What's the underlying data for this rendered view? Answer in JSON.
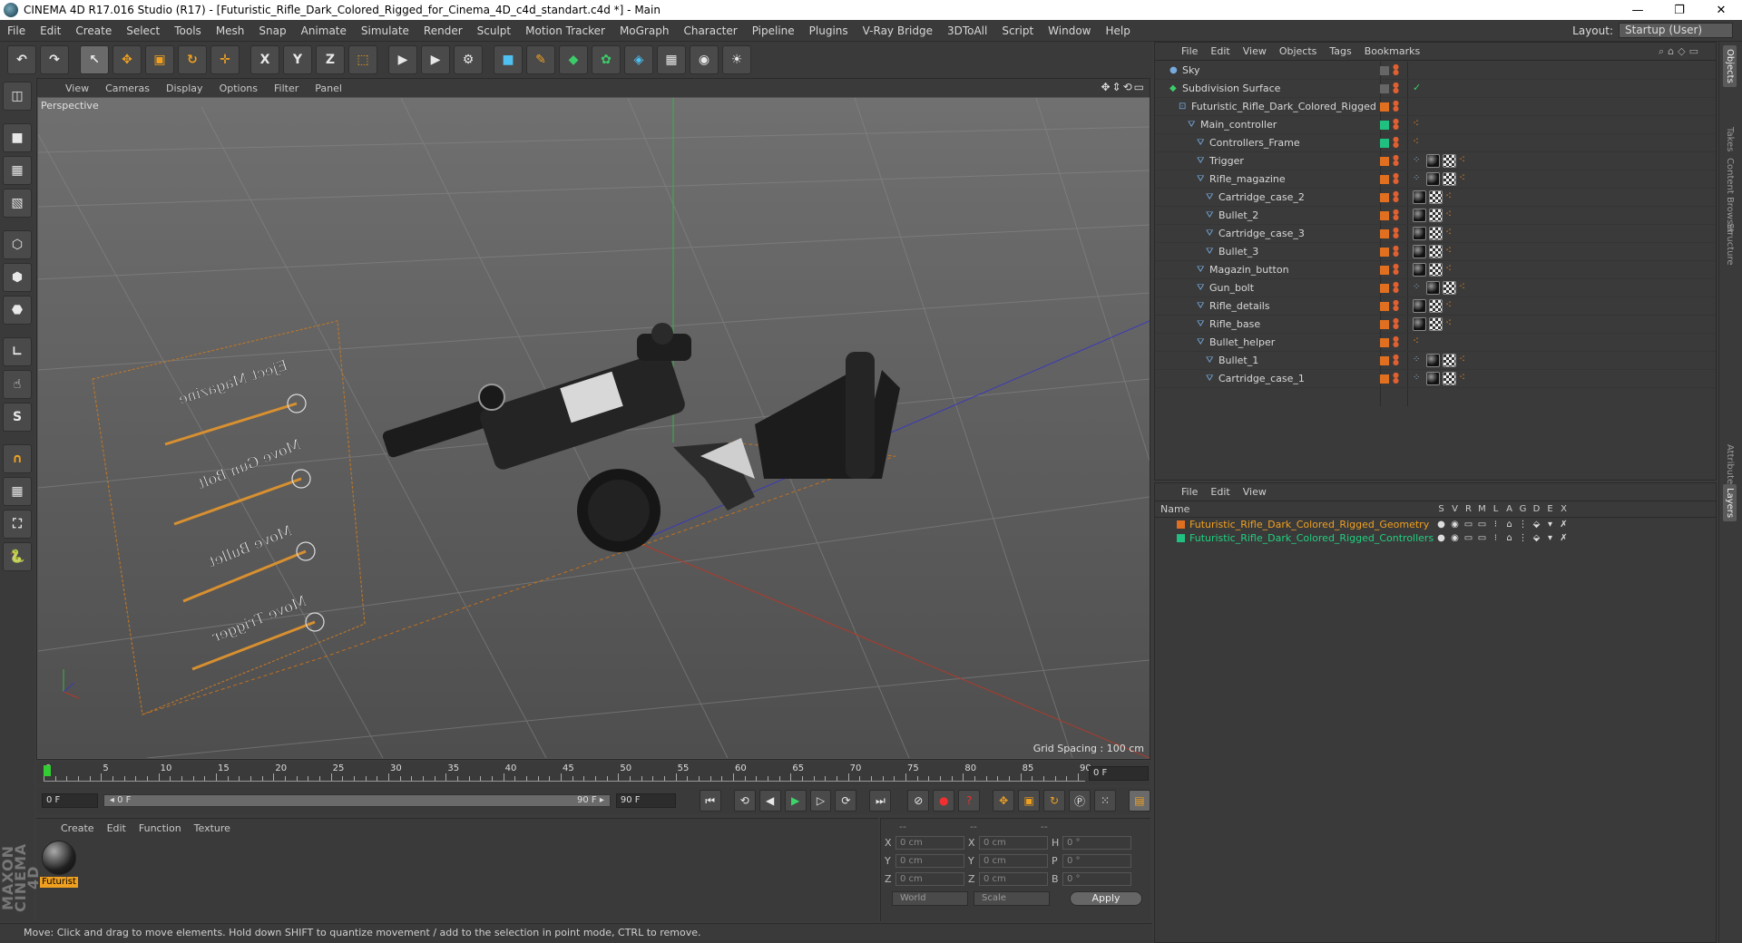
{
  "window": {
    "title": "CINEMA 4D R17.016 Studio (R17) - [Futuristic_Rifle_Dark_Colored_Rigged_for_Cinema_4D_c4d_standart.c4d *] - Main",
    "minimize": "—",
    "maximize": "❐",
    "close": "✕"
  },
  "menu": [
    "File",
    "Edit",
    "Create",
    "Select",
    "Tools",
    "Mesh",
    "Snap",
    "Animate",
    "Simulate",
    "Render",
    "Sculpt",
    "Motion Tracker",
    "MoGraph",
    "Character",
    "Pipeline",
    "Plugins",
    "V-Ray Bridge",
    "3DToAll",
    "Script",
    "Window",
    "Help"
  ],
  "layout": {
    "label": "Layout:",
    "value": "Startup (User)"
  },
  "toolbar": [
    {
      "name": "undo-button",
      "g": "↶"
    },
    {
      "name": "redo-button",
      "g": "↷"
    },
    {
      "name": "select-tool-button",
      "g": "↖"
    },
    {
      "name": "move-tool-button",
      "g": "✥",
      "c": "o"
    },
    {
      "name": "scale-tool-button",
      "g": "▣",
      "c": "o"
    },
    {
      "name": "rotate-tool-button",
      "g": "↻",
      "c": "o"
    },
    {
      "name": "live-selection-button",
      "g": "✛",
      "c": "o"
    },
    {
      "name": "x-axis-button",
      "g": "X"
    },
    {
      "name": "y-axis-button",
      "g": "Y"
    },
    {
      "name": "z-axis-button",
      "g": "Z"
    },
    {
      "name": "coordinate-system-button",
      "g": "⬚",
      "c": "o"
    },
    {
      "name": "render-view-button",
      "g": "▶"
    },
    {
      "name": "render-picture-viewer-button",
      "g": "▶"
    },
    {
      "name": "render-settings-button",
      "g": "⚙"
    },
    {
      "name": "cube-button",
      "g": "■",
      "c": "c"
    },
    {
      "name": "pen-button",
      "g": "✎",
      "c": "o"
    },
    {
      "name": "subdivision-button",
      "g": "◆",
      "c": "g"
    },
    {
      "name": "mograph-button",
      "g": "✿",
      "c": "g"
    },
    {
      "name": "deformer-button",
      "g": "◈",
      "c": "c"
    },
    {
      "name": "floor-button",
      "g": "▦"
    },
    {
      "name": "camera-button",
      "g": "◉"
    },
    {
      "name": "light-button",
      "g": "☀"
    }
  ],
  "left_toolbar": [
    "make-editable",
    "model-mode",
    "texture-mode",
    "workplane-mode",
    "points-mode",
    "edges-mode",
    "polygons-mode",
    "axis-mode",
    "tweak-mode",
    "solo-mode",
    "magnet-tool",
    "snap-toggle",
    "lock-workplane",
    "python-tool"
  ],
  "viewport": {
    "menu": [
      "View",
      "Cameras",
      "Display",
      "Options",
      "Filter",
      "Panel"
    ],
    "camera": "Perspective",
    "grid_spacing": "Grid Spacing : 100 cm",
    "nav": "✥⇕⟲▭",
    "sliders": [
      "Eject Magazine",
      "Move Gun Bolt",
      "Move Bullet",
      "Move Trigger"
    ]
  },
  "timeline": {
    "ticks": [
      0,
      5,
      10,
      15,
      20,
      25,
      30,
      35,
      40,
      45,
      50,
      55,
      60,
      65,
      70,
      75,
      80,
      85,
      90
    ],
    "current": "0 F",
    "start": "0 F",
    "slider_left": "◂ 0 F",
    "slider_right": "90 F ▸",
    "end": "90 F"
  },
  "materials": {
    "menu": [
      "Create",
      "Edit",
      "Function",
      "Texture"
    ],
    "items": [
      {
        "name": "Futurist"
      }
    ]
  },
  "coords": {
    "header": [
      "--",
      "--",
      "--"
    ],
    "rows": [
      {
        "a1": "X",
        "v1": "0 cm",
        "a2": "X",
        "v2": "0 cm",
        "a3": "H",
        "v3": "0 °"
      },
      {
        "a1": "Y",
        "v1": "0 cm",
        "a2": "Y",
        "v2": "0 cm",
        "a3": "P",
        "v3": "0 °"
      },
      {
        "a1": "Z",
        "v1": "0 cm",
        "a2": "Z",
        "v2": "0 cm",
        "a3": "B",
        "v3": "0 °"
      }
    ],
    "space": "World",
    "mode": "Scale",
    "apply": "Apply"
  },
  "maxon_logo": "MAXON CINEMA 4D",
  "status": "Move: Click and drag to move elements. Hold down SHIFT to quantize movement / add to the selection in point mode, CTRL to remove.",
  "objects": {
    "menu": [
      "File",
      "Edit",
      "View",
      "Objects",
      "Tags",
      "Bookmarks"
    ],
    "header_icons": "⌕⌂◇▭",
    "rows": [
      {
        "name": "Sky",
        "depth": 0,
        "layer": "n",
        "tags": []
      },
      {
        "name": "Subdivision Surface",
        "depth": 0,
        "layer": "n",
        "tags": [
          "check"
        ]
      },
      {
        "name": "Futuristic_Rifle_Dark_Colored_Rigged",
        "depth": 1,
        "layer": "o",
        "tags": []
      },
      {
        "name": "Main_controller",
        "depth": 2,
        "layer": "g",
        "tags": [
          "d"
        ]
      },
      {
        "name": "Controllers_Frame",
        "depth": 3,
        "layer": "g",
        "tags": [
          "d"
        ]
      },
      {
        "name": "Trigger",
        "depth": 3,
        "layer": "o",
        "tags": [
          "i",
          "m",
          "k",
          "d"
        ]
      },
      {
        "name": "Rifle_magazine",
        "depth": 3,
        "layer": "o",
        "tags": [
          "i",
          "m",
          "k",
          "d"
        ]
      },
      {
        "name": "Cartridge_case_2",
        "depth": 4,
        "layer": "o",
        "tags": [
          "m",
          "k",
          "d"
        ]
      },
      {
        "name": "Bullet_2",
        "depth": 4,
        "layer": "o",
        "tags": [
          "m",
          "k",
          "d"
        ]
      },
      {
        "name": "Cartridge_case_3",
        "depth": 4,
        "layer": "o",
        "tags": [
          "m",
          "k",
          "d"
        ]
      },
      {
        "name": "Bullet_3",
        "depth": 4,
        "layer": "o",
        "tags": [
          "m",
          "k",
          "d"
        ]
      },
      {
        "name": "Magazin_button",
        "depth": 3,
        "layer": "o",
        "tags": [
          "m",
          "k",
          "d"
        ]
      },
      {
        "name": "Gun_bolt",
        "depth": 3,
        "layer": "o",
        "tags": [
          "i",
          "m",
          "k",
          "d"
        ]
      },
      {
        "name": "Rifle_details",
        "depth": 3,
        "layer": "o",
        "tags": [
          "m",
          "k",
          "d"
        ]
      },
      {
        "name": "Rifle_base",
        "depth": 3,
        "layer": "o",
        "tags": [
          "m",
          "k",
          "d"
        ]
      },
      {
        "name": "Bullet_helper",
        "depth": 3,
        "layer": "o",
        "tags": [
          "d"
        ]
      },
      {
        "name": "Bullet_1",
        "depth": 4,
        "layer": "o",
        "tags": [
          "i",
          "m",
          "k",
          "d"
        ]
      },
      {
        "name": "Cartridge_case_1",
        "depth": 4,
        "layer": "o",
        "tags": [
          "i",
          "m",
          "k",
          "d"
        ]
      }
    ]
  },
  "layers": {
    "menu": [
      "File",
      "Edit",
      "View"
    ],
    "name_col": "Name",
    "cols": [
      "S",
      "V",
      "R",
      "M",
      "L",
      "A",
      "G",
      "D",
      "E",
      "X"
    ],
    "rows": [
      {
        "name": "Futuristic_Rifle_Dark_Colored_Rigged_Geometry",
        "color": "#e07020"
      },
      {
        "name": "Futuristic_Rifle_Dark_Colored_Rigged_Controllers",
        "color": "#20c080"
      }
    ]
  },
  "side_tabs": [
    "Objects",
    "Takes",
    "Content Browser",
    "Structure",
    "Attributes",
    "Layers"
  ]
}
